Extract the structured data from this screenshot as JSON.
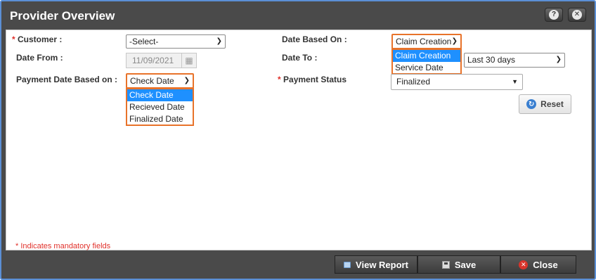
{
  "window": {
    "title": "Provider Overview",
    "help_icon": "?",
    "close_icon": "✕"
  },
  "form": {
    "required_marker": "*",
    "customer": {
      "label": "Customer :",
      "value": "-Select-"
    },
    "date_based_on": {
      "label": "Date Based On :",
      "value": "Claim Creation",
      "options": [
        "Claim Creation",
        "Service Date"
      ],
      "selected_index": 0
    },
    "date_from": {
      "label": "Date From :",
      "value": "11/09/2021"
    },
    "date_to": {
      "label": "Date To :",
      "value": "Last 30 days"
    },
    "payment_date_based_on": {
      "label": "Payment Date Based on :",
      "value": "Check Date",
      "options": [
        "Check Date",
        "Recieved Date",
        "Finalized Date"
      ],
      "selected_index": 0
    },
    "payment_status": {
      "label": "Payment Status",
      "value": "Finalized"
    },
    "reset_label": "Reset",
    "mandatory_note": "* Indicates mandatory fields"
  },
  "footer": {
    "view_report_label": "View Report",
    "save_label": "Save",
    "close_label": "Close"
  },
  "colors": {
    "highlight": "#e8732a",
    "selected_option": "#1e90ff",
    "required": "#e0302a"
  }
}
